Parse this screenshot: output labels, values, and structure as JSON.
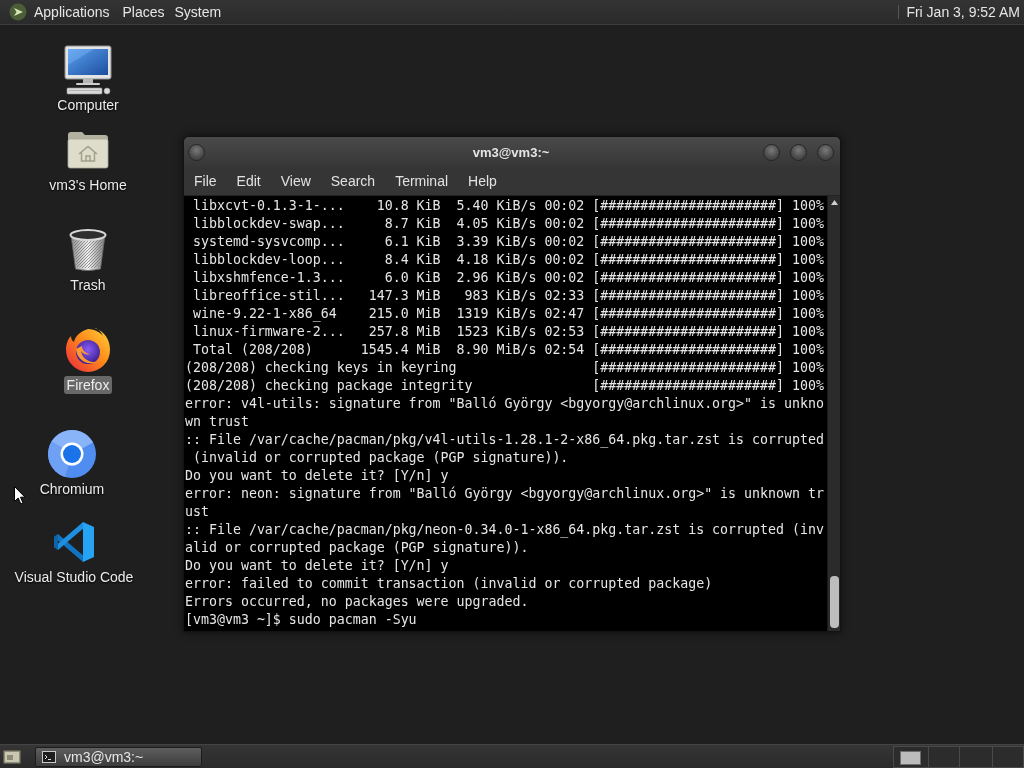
{
  "top_panel": {
    "menus": [
      "Applications",
      "Places",
      "System"
    ],
    "clock": "Fri Jan 3, 9:52 AM"
  },
  "desktop": {
    "icons": [
      {
        "kind": "computer",
        "label": "Computer",
        "selected": false
      },
      {
        "kind": "home",
        "label": "vm3's Home",
        "selected": false
      },
      {
        "kind": "trash",
        "label": "Trash",
        "selected": false
      },
      {
        "kind": "firefox",
        "label": "Firefox",
        "selected": true
      },
      {
        "kind": "chromium",
        "label": "Chromium",
        "selected": false
      },
      {
        "kind": "vscode",
        "label": "Visual Studio Code",
        "selected": false
      }
    ]
  },
  "window": {
    "title": "vm3@vm3:~",
    "menu": [
      "File",
      "Edit",
      "View",
      "Search",
      "Terminal",
      "Help"
    ],
    "lines": [
      " libxcvt-0.1.3-1-...    10.8 KiB  5.40 KiB/s 00:02 [######################] 100%",
      " libblockdev-swap...     8.7 KiB  4.05 KiB/s 00:02 [######################] 100%",
      " systemd-sysvcomp...     6.1 KiB  3.39 KiB/s 00:02 [######################] 100%",
      " libblockdev-loop...     8.4 KiB  4.18 KiB/s 00:02 [######################] 100%",
      " libxshmfence-1.3...     6.0 KiB  2.96 KiB/s 00:02 [######################] 100%",
      " libreoffice-stil...   147.3 MiB   983 KiB/s 02:33 [######################] 100%",
      " wine-9.22-1-x86_64    215.0 MiB  1319 KiB/s 02:47 [######################] 100%",
      " linux-firmware-2...   257.8 MiB  1523 KiB/s 02:53 [######################] 100%",
      " Total (208/208)      1545.4 MiB  8.90 MiB/s 02:54 [######################] 100%",
      "(208/208) checking keys in keyring                 [######################] 100%",
      "(208/208) checking package integrity               [######################] 100%",
      "error: v4l-utils: signature from \"Balló György <bgyorgy@archlinux.org>\" is unkno",
      "wn trust",
      ":: File /var/cache/pacman/pkg/v4l-utils-1.28.1-2-x86_64.pkg.tar.zst is corrupted",
      " (invalid or corrupted package (PGP signature)).",
      "Do you want to delete it? [Y/n] y",
      "error: neon: signature from \"Balló György <bgyorgy@archlinux.org>\" is unknown tr",
      "ust",
      ":: File /var/cache/pacman/pkg/neon-0.34.0-1-x86_64.pkg.tar.zst is corrupted (inv",
      "alid or corrupted package (PGP signature)).",
      "Do you want to delete it? [Y/n] y",
      "error: failed to commit transaction (invalid or corrupted package)",
      "Errors occurred, no packages were upgraded.",
      "[vm3@vm3 ~]$ sudo pacman -Syu"
    ]
  },
  "taskbar": {
    "windows": [
      {
        "label": "vm3@vm3:~",
        "selected": true
      }
    ]
  }
}
